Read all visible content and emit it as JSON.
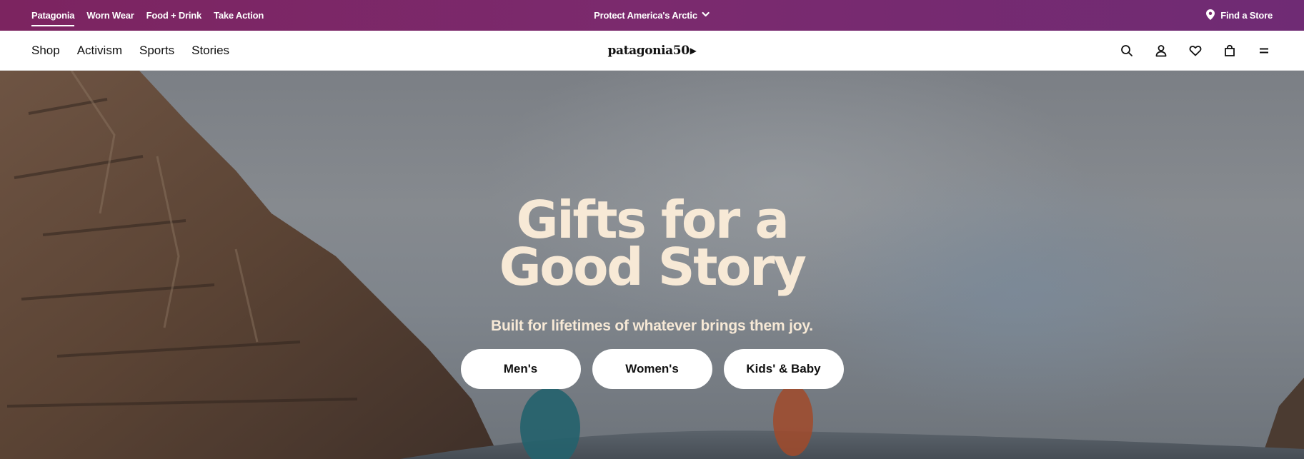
{
  "utility": {
    "links": [
      {
        "label": "Patagonia",
        "active": true
      },
      {
        "label": "Worn Wear",
        "active": false
      },
      {
        "label": "Food + Drink",
        "active": false
      },
      {
        "label": "Take Action",
        "active": false
      }
    ],
    "campaign_label": "Protect America's Arctic",
    "find_store_label": "Find a Store"
  },
  "nav": {
    "items": [
      "Shop",
      "Activism",
      "Sports",
      "Stories"
    ],
    "logo_text": "patagonia",
    "logo_suffix": "50",
    "icons": [
      "search-icon",
      "account-icon",
      "wishlist-icon",
      "bag-icon",
      "menu-icon"
    ]
  },
  "hero": {
    "headline_line1": "Gifts for a",
    "headline_line2": "Good Story",
    "subhead": "Built for lifetimes of whatever brings them joy.",
    "ctas": [
      "Men's",
      "Women's",
      "Kids' & Baby"
    ]
  },
  "colors": {
    "utility_bar": "#7b2a6e",
    "headline": "#f7e9d6",
    "button_bg": "#ffffff"
  }
}
